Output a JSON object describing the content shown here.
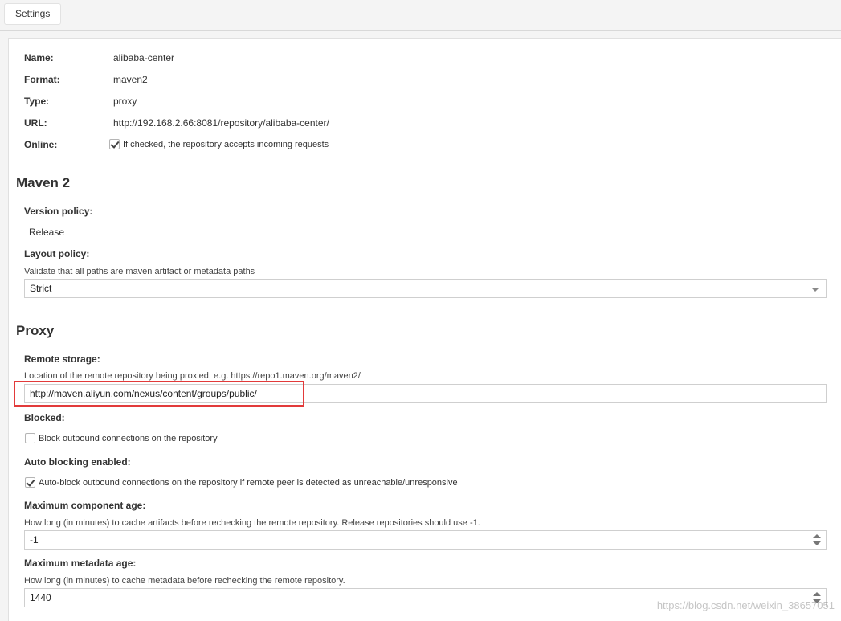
{
  "tabs": [
    {
      "label": "Settings"
    }
  ],
  "general": {
    "name_label": "Name:",
    "name_value": "alibaba-center",
    "format_label": "Format:",
    "format_value": "maven2",
    "type_label": "Type:",
    "type_value": "proxy",
    "url_label": "URL:",
    "url_value": "http://192.168.2.66:8081/repository/alibaba-center/",
    "online_label": "Online:",
    "online_checked": true,
    "online_text": "If checked, the repository accepts incoming requests"
  },
  "maven2": {
    "title": "Maven 2",
    "version_policy_label": "Version policy:",
    "version_policy_value": "Release",
    "layout_policy_label": "Layout policy:",
    "layout_policy_help": "Validate that all paths are maven artifact or metadata paths",
    "layout_policy_value": "Strict"
  },
  "proxy": {
    "title": "Proxy",
    "remote_storage_label": "Remote storage:",
    "remote_storage_help": "Location of the remote repository being proxied, e.g. https://repo1.maven.org/maven2/",
    "remote_storage_value": "http://maven.aliyun.com/nexus/content/groups/public/",
    "blocked_label": "Blocked:",
    "blocked_checked": false,
    "blocked_text": "Block outbound connections on the repository",
    "auto_blocking_label": "Auto blocking enabled:",
    "auto_blocking_checked": true,
    "auto_blocking_text": "Auto-block outbound connections on the repository if remote peer is detected as unreachable/unresponsive",
    "max_component_age_label": "Maximum component age:",
    "max_component_age_help": "How long (in minutes) to cache artifacts before rechecking the remote repository. Release repositories should use -1.",
    "max_component_age_value": "-1",
    "max_metadata_age_label": "Maximum metadata age:",
    "max_metadata_age_help": "How long (in minutes) to cache metadata before rechecking the remote repository.",
    "max_metadata_age_value": "1440"
  },
  "annotation": {
    "color": "#e23a3a"
  },
  "watermark": "https://blog.csdn.net/weixin_38657051"
}
